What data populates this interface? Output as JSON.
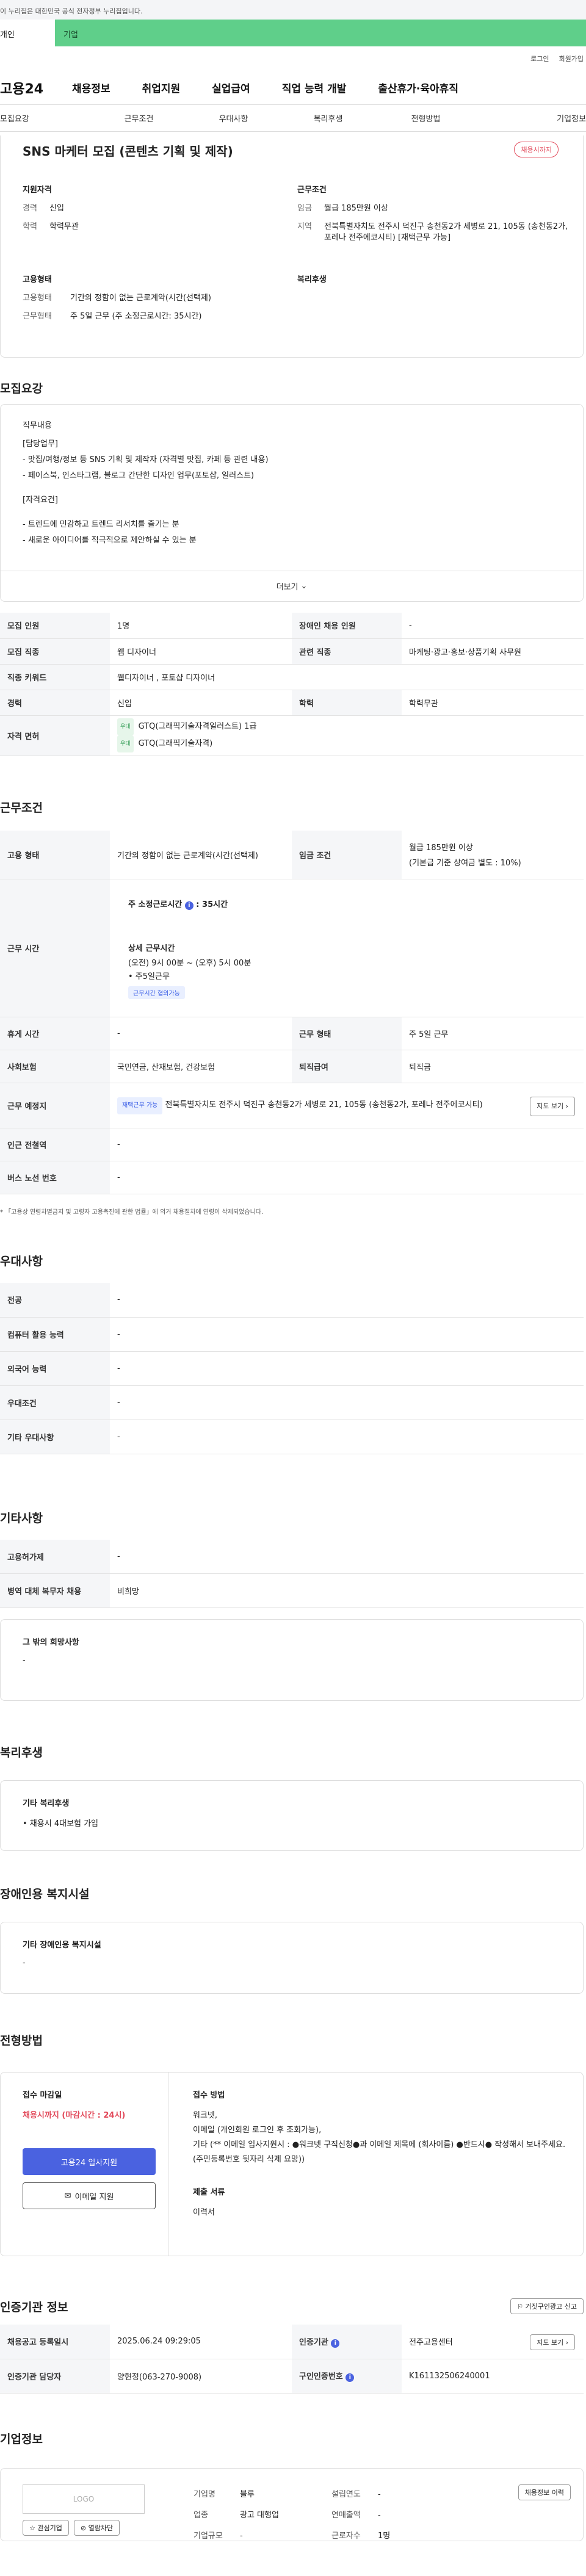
{
  "gov_notice": "이 누리집은 대한민국 공식 전자정부 누리집입니다.",
  "type_tabs": [
    "개인",
    "기업"
  ],
  "util": {
    "login": "로그인",
    "signup": "회원가입"
  },
  "logo": "고용24",
  "gnb": [
    "채용정보",
    "취업지원",
    "실업급여",
    "직업 능력 개발",
    "출산휴가·육아휴직"
  ],
  "lnb": [
    "모집요강",
    "근무조건",
    "우대사항",
    "복리후생",
    "전형방법",
    "기업정보"
  ],
  "job": {
    "title": "SNS 마케터 모집 (콘텐츠 기획 및 제작)",
    "deadline_badge": "채용시까지",
    "qual_title": "지원자격",
    "qual": [
      {
        "k": "경력",
        "v": "신입"
      },
      {
        "k": "학력",
        "v": "학력무관"
      }
    ],
    "cond_title": "근무조건",
    "cond": [
      {
        "k": "임금",
        "v": "월급 185만원 이상"
      },
      {
        "k": "지역",
        "v": "전북특별자치도 전주시 덕진구 송천동2가 세병로 21, 105동 (송천동2가, 포레나 전주에코시티) [재택근무 가능]"
      }
    ],
    "emp_title": "고용형태",
    "emp": [
      {
        "k": "고용형태",
        "v": "기간의 정함이 없는 근로계약(시간(선택제)"
      },
      {
        "k": "근무형태",
        "v": "주 5일 근무 (주 소정근로시간: 35시간)"
      }
    ],
    "welfare_title": "복리후생"
  },
  "sections": {
    "recruit": "모집요강",
    "work": "근무조건",
    "pref": "우대사항",
    "etc": "기타사항",
    "welfare": "복리후생",
    "disabled": "장애인용 복지시설",
    "process": "전형방법",
    "cert": "인증기관 정보",
    "company": "기업정보"
  },
  "duty": {
    "heading": "직무내용",
    "lines": [
      "[담당업무]",
      "- 맛집/여행/정보 등 SNS 기획 및 제작자 (자격별 맛집, 카페 등 관련 내용)",
      "- 페이스북, 인스타그램, 블로그 간단한 디자인 업무(포토샵, 일러스트)",
      "[자격요건]",
      "- 트렌드에 민감하고 트렌드 리서치를 즐기는 분",
      "- 새로운 아이디어를 적극적으로 제안하실 수 있는 분"
    ],
    "more": "더보기"
  },
  "recruit_table": {
    "headcount_label": "모집 인원",
    "headcount": "1명",
    "disabled_label": "장애인 채용 인원",
    "disabled": "-",
    "job_label": "모집 직종",
    "job": "웹 디자이너",
    "rel_label": "관련 직종",
    "rel": "마케팅·광고·홍보·상품기획 사무원",
    "kw_label": "직종 키워드",
    "kw": "웹디자이너 , 포토샵 디자이너",
    "career_label": "경력",
    "career": "신입",
    "edu_label": "학력",
    "edu": "학력무관",
    "license_label": "자격 면허",
    "licenses": [
      {
        "tag": "우대",
        "name": "GTQ(그래픽기술자격일러스트) 1급"
      },
      {
        "tag": "우대",
        "name": "GTQ(그래픽기술자격)"
      }
    ]
  },
  "work_table": {
    "emp_label": "고용 형태",
    "emp": "기간의 정함이 없는 근로계약(시간(선택제)",
    "wage_label": "임금 조건",
    "wage": "월급 185만원 이상",
    "wage_note": "(기본급 기준 상여금 별도 : 10%)",
    "hours_label": "근무 시간",
    "hours_title": "주 소정근로시간",
    "hours_value": "35시간",
    "detail_title": "상세 근무시간",
    "detail_lines": [
      "(오전) 9시 00분 ~ (오후) 5시 00분",
      "• 주5일근무"
    ],
    "hours_tag": "근무시간 협의가능",
    "break_label": "휴게 시간",
    "break": "-",
    "form_label": "근무 형태",
    "form": "주 5일 근무",
    "ins_label": "사회보험",
    "ins": "국민연금, 산재보험, 건강보험",
    "sev_label": "퇴직급여",
    "sev": "퇴직금",
    "loc_label": "근무 예정지",
    "loc_tag": "재택근무 가능",
    "loc": "전북특별자치도 전주시 덕진구 송천동2가 세병로 21, 105동 (송천동2가, 포레나 전주에코시티)",
    "map_btn": "지도 보기",
    "sub_label": "인근 전철역",
    "sub": "-",
    "bus_label": "버스 노선 번호",
    "bus": "-"
  },
  "notice": "* 「고용상 연령차별금지 및 고령자 고용촉진에 관한 법률」에 의거 채용절차에 연령이 삭제되었습니다.",
  "pref_table": [
    {
      "k": "전공",
      "v": "-"
    },
    {
      "k": "컴퓨터 활용 능력",
      "v": "-"
    },
    {
      "k": "외국어 능력",
      "v": "-"
    },
    {
      "k": "우대조건",
      "v": "-"
    },
    {
      "k": "기타 우대사항",
      "v": "-"
    }
  ],
  "etc_table": [
    {
      "k": "고용허가제",
      "v": "-"
    },
    {
      "k": "병역 대체 복무자 채용",
      "v": "비희망"
    }
  ],
  "etc_box": {
    "title": "그 밖의 희망사항",
    "value": "-"
  },
  "welfare_box": {
    "title": "기타 복리후생",
    "value": "• 채용시 4대보험 가입"
  },
  "disabled_box": {
    "title": "기타 장애인용 복지시설",
    "value": "-"
  },
  "process": {
    "deadline_title": "접수 마감일",
    "deadline": "채용시까지 (마감시간 : 24시)",
    "apply_btn": "고용24 입사지원",
    "email_btn": "이메일 지원",
    "method_title": "접수 방법",
    "method_lines": [
      "워크넷,",
      "이메일 (개인회원 로그인 후 조회가능),",
      "기타 (** 이메일 입사지원시 : ●워크넷 구직신청●과 이메일 제목에 (회사이름) ●반드시● 작성해서 보내주세요. (주민등록번호 뒷자리 삭제 요망))"
    ],
    "docs_title": "제출 서류",
    "docs": "이력서"
  },
  "cert": {
    "report_btn": "거짓구인광고 신고",
    "reg_label": "채용공고 등록일시",
    "reg": "2025.06.24 09:29:05",
    "org_label": "인증기관",
    "org": "전주고용센터",
    "map_btn": "지도 보기",
    "mgr_label": "인증기관 담당자",
    "mgr": "양현정(063-270-9008)",
    "no_label": "구인인증번호",
    "no": "K161132506240001"
  },
  "company": {
    "logo": "LOGO",
    "fav_btn": "관심기업",
    "block_btn": "열람차단",
    "info_btn": "채용정보 이력",
    "rows": [
      [
        {
          "k": "기업명",
          "v": "블루"
        },
        {
          "k": "설립연도",
          "v": "-"
        }
      ],
      [
        {
          "k": "업종",
          "v": "광고 대행업"
        },
        {
          "k": "연매출액",
          "v": "-"
        }
      ],
      [
        {
          "k": "기업규모",
          "v": "-"
        },
        {
          "k": "근로자수",
          "v": "1명"
        }
      ]
    ]
  }
}
